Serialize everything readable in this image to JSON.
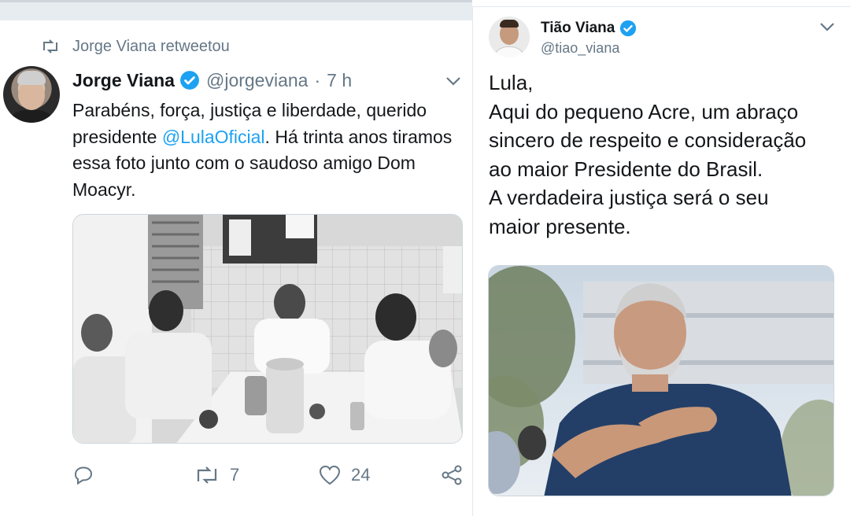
{
  "left_tweet": {
    "retweeted_by": "Jorge Viana retweetou",
    "author_name": "Jorge Viana",
    "author_handle": "@jorgeviana",
    "separator": "·",
    "time": "7 h",
    "text_before": "Parabéns, força, justiça e liberdade, querido presidente ",
    "mention": "@LulaOficial",
    "text_after": ". Há trinta anos tiramos essa foto junto com o saudoso amigo  Dom Moacyr.",
    "actions": {
      "reply_count": "",
      "retweet_count": "7",
      "like_count": "24"
    }
  },
  "right_tweet": {
    "author_name": "Tião Viana",
    "author_handle": "@tiao_viana",
    "text_lines": [
      "Lula,",
      "Aqui do pequeno Acre, um abraço",
      "sincero de respeito e consideração",
      "ao maior Presidente do Brasil.",
      "A verdadeira justiça será o seu",
      "maior presente."
    ]
  },
  "colors": {
    "accent": "#1da1f2",
    "muted": "#657786",
    "text": "#14171a"
  },
  "icons": [
    "retweet-icon",
    "verified-badge-icon",
    "chevron-down-icon",
    "reply-icon",
    "retweet-action-icon",
    "like-icon",
    "share-icon"
  ]
}
